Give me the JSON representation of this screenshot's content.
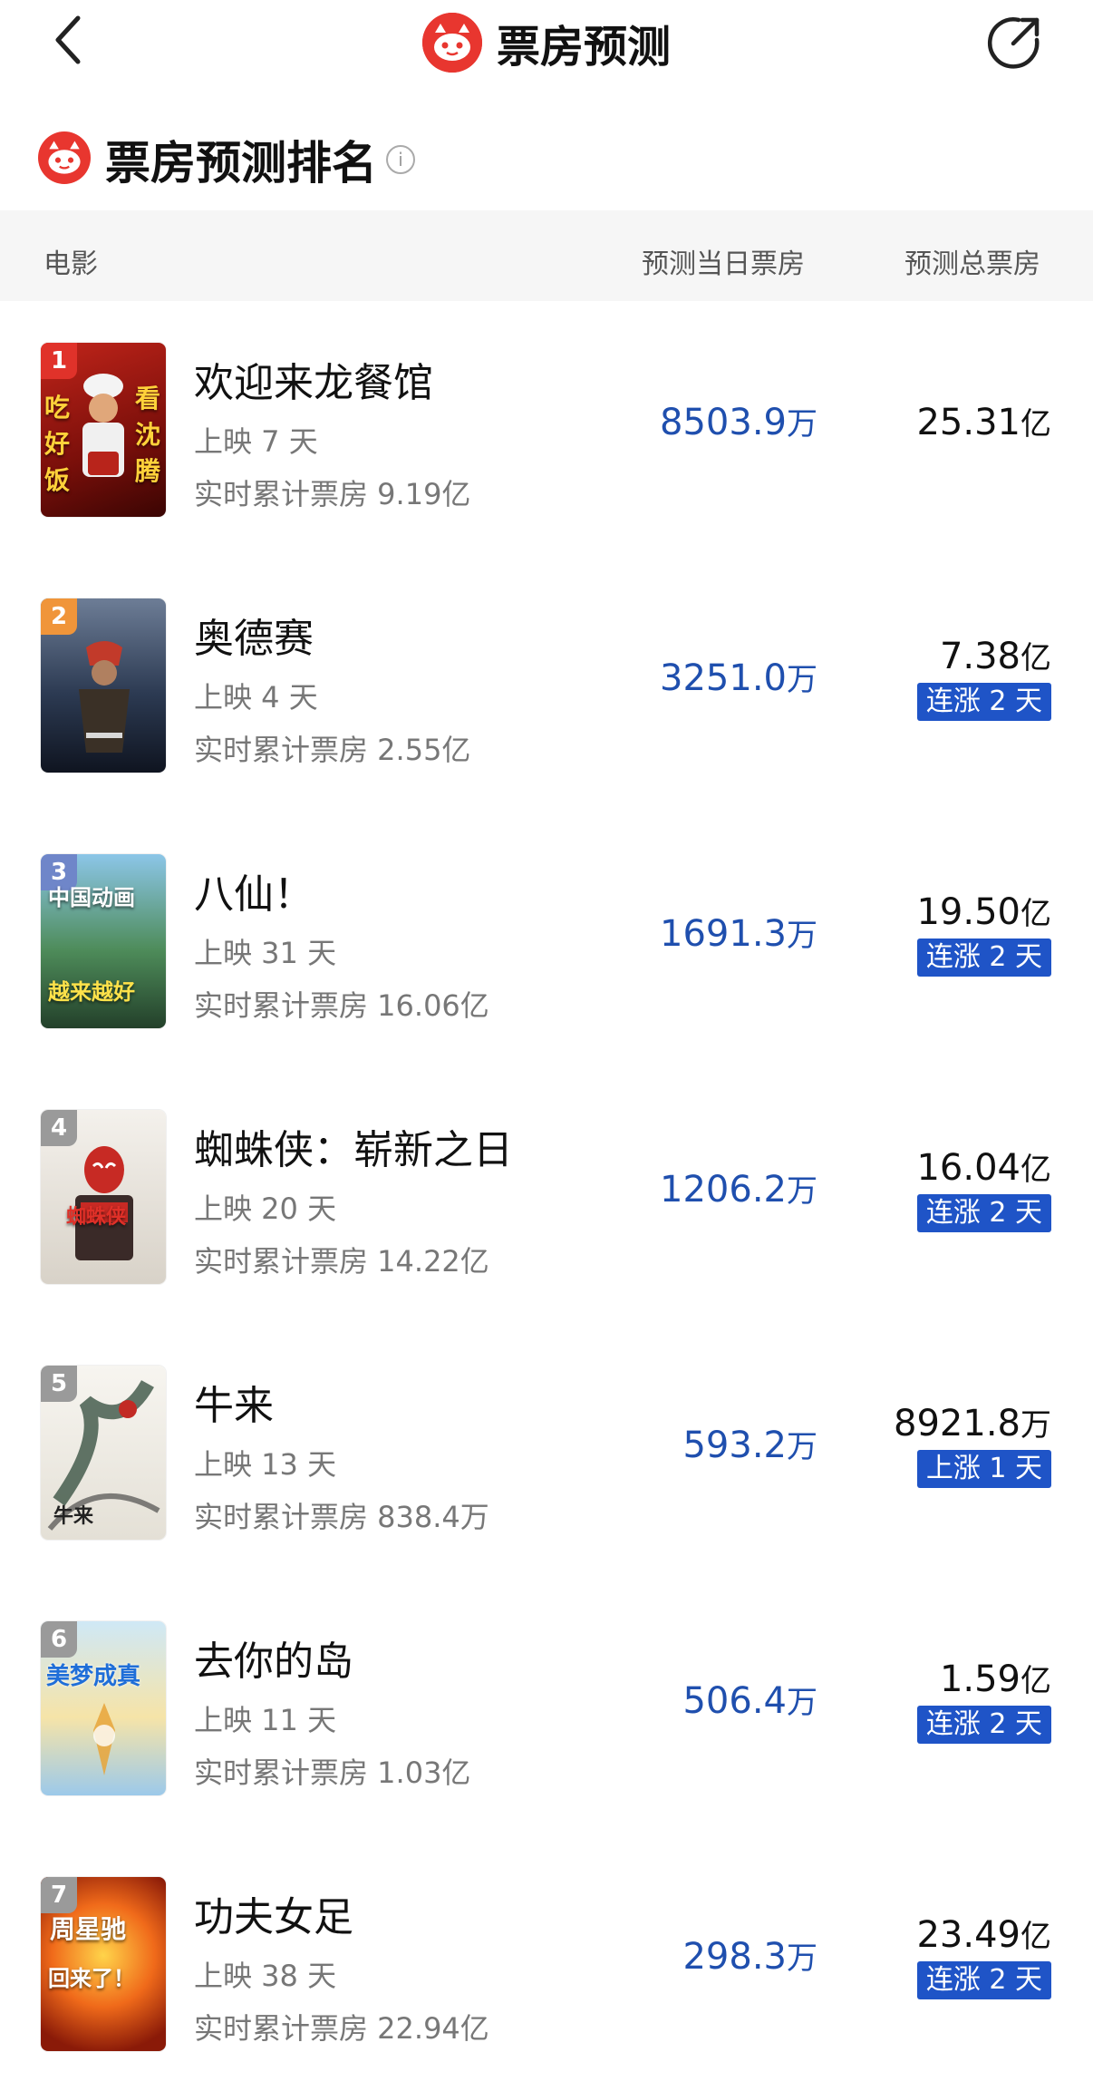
{
  "nav": {
    "title": "票房预测"
  },
  "section": {
    "title": "票房预测排名",
    "info_icon": "i"
  },
  "header": {
    "movie": "电影",
    "day": "预测当日票房",
    "total": "预测总票房"
  },
  "colors": {
    "accent": "#1f4fae",
    "badge": "#1f54c7",
    "brand": "#e8362f"
  },
  "rows": [
    {
      "rank": "1",
      "name": "欢迎来龙餐馆",
      "days": "上映 7 天",
      "cum": "实时累计票房 9.19亿",
      "day_value": "8503.9",
      "day_unit": "万",
      "total_value": "25.31",
      "total_unit": "亿",
      "badge": "",
      "poster_left": "吃好饭",
      "poster_right": "看沈腾"
    },
    {
      "rank": "2",
      "name": "奥德赛",
      "days": "上映 4 天",
      "cum": "实时累计票房 2.55亿",
      "day_value": "3251.0",
      "day_unit": "万",
      "total_value": "7.38",
      "total_unit": "亿",
      "badge": "连涨 2 天",
      "poster_left": "",
      "poster_right": ""
    },
    {
      "rank": "3",
      "name": "八仙！",
      "days": "上映 31 天",
      "cum": "实时累计票房 16.06亿",
      "day_value": "1691.3",
      "day_unit": "万",
      "total_value": "19.50",
      "total_unit": "亿",
      "badge": "连涨 2 天",
      "poster_left": "中国动画",
      "poster_right": "越来越好"
    },
    {
      "rank": "4",
      "name": "蜘蛛侠：崭新之日",
      "days": "上映 20 天",
      "cum": "实时累计票房 14.22亿",
      "day_value": "1206.2",
      "day_unit": "万",
      "total_value": "16.04",
      "total_unit": "亿",
      "badge": "连涨 2 天",
      "poster_left": "蜘蛛侠",
      "poster_right": ""
    },
    {
      "rank": "5",
      "name": "牛来",
      "days": "上映 13 天",
      "cum": "实时累计票房 838.4万",
      "day_value": "593.2",
      "day_unit": "万",
      "total_value": "8921.8",
      "total_unit": "万",
      "badge": "上涨 1 天",
      "poster_left": "牛来",
      "poster_right": ""
    },
    {
      "rank": "6",
      "name": "去你的岛",
      "days": "上映 11 天",
      "cum": "实时累计票房 1.03亿",
      "day_value": "506.4",
      "day_unit": "万",
      "total_value": "1.59",
      "total_unit": "亿",
      "badge": "连涨 2 天",
      "poster_left": "美梦成真",
      "poster_right": ""
    },
    {
      "rank": "7",
      "name": "功夫女足",
      "days": "上映 38 天",
      "cum": "实时累计票房 22.94亿",
      "day_value": "298.3",
      "day_unit": "万",
      "total_value": "23.49",
      "total_unit": "亿",
      "badge": "连涨 2 天",
      "poster_left": "周星驰",
      "poster_right": "回来了！"
    }
  ]
}
